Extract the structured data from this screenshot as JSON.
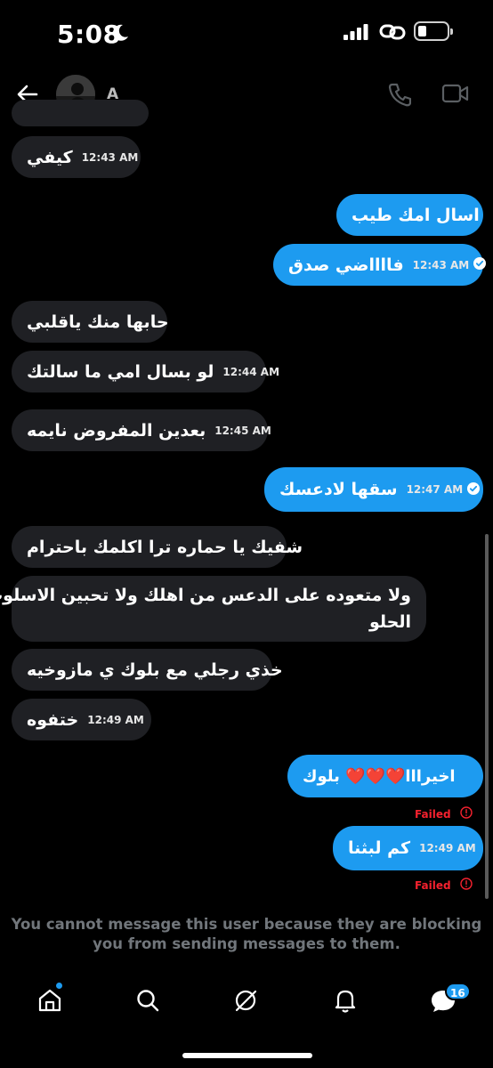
{
  "status_bar": {
    "time": "5:08"
  },
  "header": {
    "name": "A"
  },
  "messages": [
    {
      "dir": "in",
      "text": "",
      "time": ""
    },
    {
      "dir": "in",
      "text": "كيفي",
      "time": "12:43 AM"
    },
    {
      "dir": "out",
      "text": "اسال امك طيب",
      "time": ""
    },
    {
      "dir": "out",
      "text": "فااااضي صدق",
      "time": "12:43 AM"
    },
    {
      "dir": "in",
      "text": "حابها منك ياقلبي",
      "time": ""
    },
    {
      "dir": "in",
      "text": "لو بسال امي ما سالتك",
      "time": "12:44 AM"
    },
    {
      "dir": "in",
      "text": "بعدين المفروض نايمه",
      "time": "12:45 AM"
    },
    {
      "dir": "out",
      "text": "سقها لادعسك",
      "time": "12:47 AM"
    },
    {
      "dir": "in",
      "text": "شفيك يا حماره ترا اكلمك باحترام",
      "time": ""
    },
    {
      "dir": "in",
      "text_line1": "ولا متعوده على الدعس من اهلك ولا تحبين الاسلوب",
      "text_line2": "الحلو",
      "time": ""
    },
    {
      "dir": "in",
      "text": "خذي رجلي مع بلوك ي مازوخيه",
      "time": ""
    },
    {
      "dir": "in",
      "text": "ختفوه",
      "time": "12:49 AM"
    },
    {
      "dir": "out",
      "text": "اخيرااا❤️❤️❤️ بلوك",
      "time": "",
      "status": "Failed"
    },
    {
      "dir": "out",
      "text": "كم لبثنا",
      "time": "12:49 AM",
      "status": "Failed"
    }
  ],
  "blocked_notice_line1": "You cannot message this user because they are blocking",
  "blocked_notice_line2": "you from sending messages to them.",
  "tabbar": {
    "messages_badge": "16"
  },
  "colors": {
    "accent": "#1d9bf0",
    "incoming_bubble": "#1f2024",
    "failed": "#f4212e",
    "muted": "#71767b"
  }
}
